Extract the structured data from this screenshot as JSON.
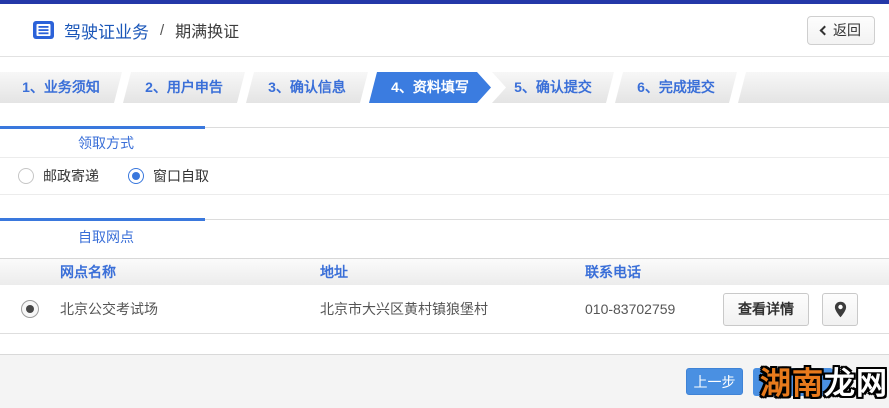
{
  "header": {
    "title_primary": "驾驶证业务",
    "title_separator": "/",
    "title_secondary": "期满换证",
    "back_label": "返回"
  },
  "wizard": {
    "steps": [
      {
        "label": "1、业务须知",
        "active": false
      },
      {
        "label": "2、用户申告",
        "active": false
      },
      {
        "label": "3、确认信息",
        "active": false
      },
      {
        "label": "4、资料填写",
        "active": true
      },
      {
        "label": "5、确认提交",
        "active": false
      },
      {
        "label": "6、完成提交",
        "active": false
      }
    ]
  },
  "pickup": {
    "section_title": "领取方式",
    "options": [
      {
        "label": "邮政寄递",
        "selected": false
      },
      {
        "label": "窗口自取",
        "selected": true
      }
    ]
  },
  "locations": {
    "section_title": "自取网点",
    "columns": {
      "name": "网点名称",
      "address": "地址",
      "phone": "联系电话"
    },
    "rows": [
      {
        "name": "北京公交考试场",
        "address": "北京市大兴区黄村镇狼堡村",
        "phone": "010-83702759",
        "detail_label": "查看详情",
        "selected": true
      }
    ]
  },
  "footer": {
    "prev_label": "上一步"
  },
  "watermark": {
    "part1": "湖南",
    "part2": "龙网"
  },
  "colors": {
    "top_bar": "#2438a8",
    "accent_blue": "#3a78dd",
    "step_text_blue": "#3a6fd8",
    "active_step_bg": "#3b7ce0",
    "primary_button_blue": "#4a90e2",
    "title_blue": "#1a56b8",
    "footer_bg": "#f4f4f4",
    "watermark_orange": "#e87a1c"
  }
}
